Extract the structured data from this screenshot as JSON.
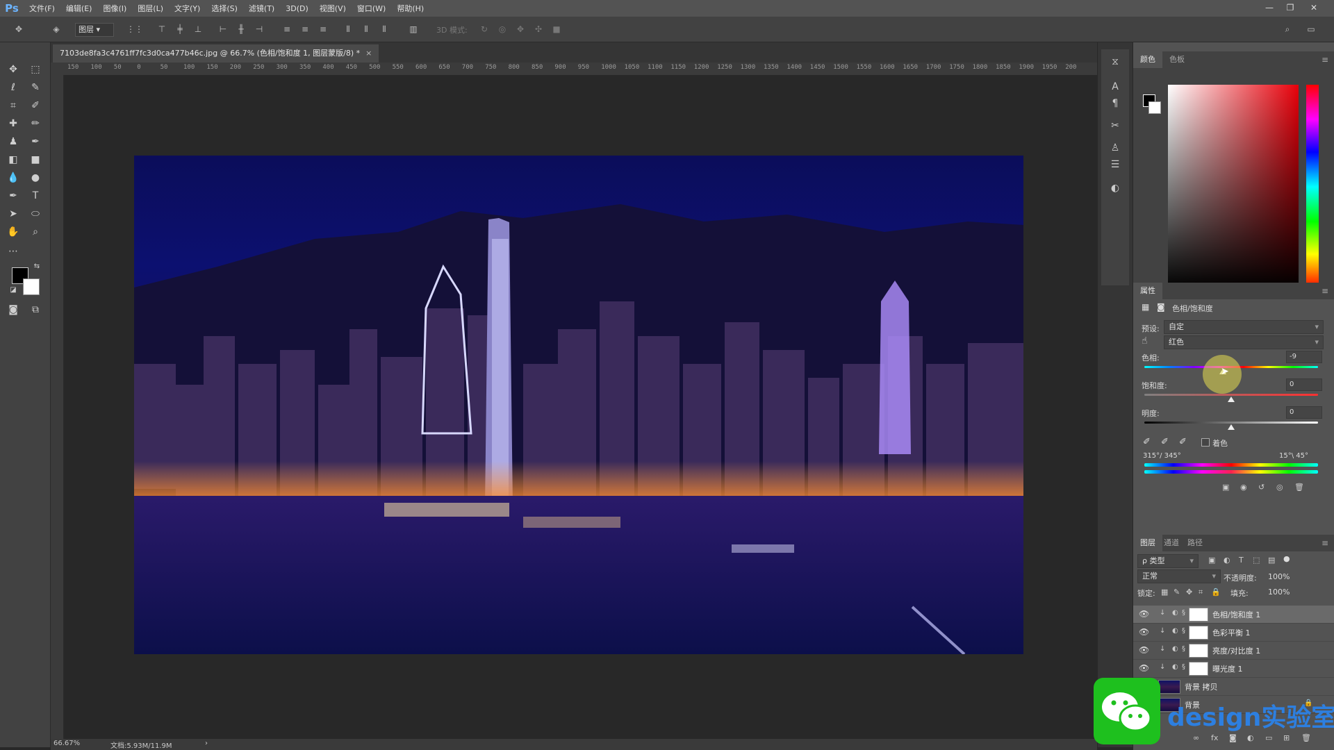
{
  "app": {
    "logo": "Ps"
  },
  "menu": [
    "文件(F)",
    "编辑(E)",
    "图像(I)",
    "图层(L)",
    "文字(Y)",
    "选择(S)",
    "滤镜(T)",
    "3D(D)",
    "视图(V)",
    "窗口(W)",
    "帮助(H)"
  ],
  "window_controls": [
    "—",
    "❐",
    "✕"
  ],
  "options_bar": {
    "layer_select": "图层",
    "mode3d": "3D 模式:"
  },
  "document": {
    "tab_title": "7103de8fa3c4761ff7fc3d0ca477b46c.jpg @ 66.7% (色相/饱和度 1, 图层蒙版/8) *",
    "close": "×"
  },
  "ruler_labels": [
    "150",
    "100",
    "50",
    "0",
    "50",
    "100",
    "150",
    "200",
    "250",
    "300",
    "350",
    "400",
    "450",
    "500",
    "550",
    "600",
    "650",
    "700",
    "750",
    "800",
    "850",
    "900",
    "950",
    "1000",
    "1050",
    "1100",
    "1150",
    "1200",
    "1250",
    "1300",
    "1350",
    "1400",
    "1450",
    "1500",
    "1550",
    "1600",
    "1650",
    "1700",
    "1750",
    "1800",
    "1850",
    "1900",
    "1950",
    "200"
  ],
  "status": {
    "zoom": "66.67%",
    "doc": "文档:5.93M/11.9M",
    "arrow": "›"
  },
  "color_panel": {
    "tabs": [
      "颜色",
      "色板"
    ],
    "fg": "#000000",
    "bg": "#ffffff",
    "base_hue": "#e8000a"
  },
  "properties": {
    "tab": "属性",
    "title": "色相/饱和度",
    "preset_label": "预设:",
    "preset_value": "自定",
    "channel_value": "红色",
    "hue_label": "色相:",
    "hue_value": "-9",
    "saturation_label": "饱和度:",
    "saturation_value": "0",
    "lightness_label": "明度:",
    "lightness_value": "0",
    "colorize_label": "着色",
    "range_left": "315°/ 345°",
    "range_right": "15°\\ 45°"
  },
  "layers_panel": {
    "tabs": [
      "图层",
      "通道",
      "路径"
    ],
    "filter_label": "ρ 类型",
    "blend_mode": "正常",
    "opacity_label": "不透明度:",
    "opacity_value": "100%",
    "lock_label": "锁定:",
    "fill_label": "填充:",
    "fill_value": "100%",
    "layers": [
      {
        "name": "色相/饱和度 1",
        "type": "adjustment",
        "selected": true
      },
      {
        "name": "色彩平衡 1",
        "type": "adjustment",
        "selected": false
      },
      {
        "name": "亮度/对比度 1",
        "type": "adjustment",
        "selected": false
      },
      {
        "name": "曝光度 1",
        "type": "adjustment",
        "selected": false
      },
      {
        "name": "背景 拷贝",
        "type": "image",
        "selected": false
      },
      {
        "name": "背景",
        "type": "image",
        "selected": false
      }
    ]
  },
  "watermark": {
    "text": "design实验室"
  }
}
